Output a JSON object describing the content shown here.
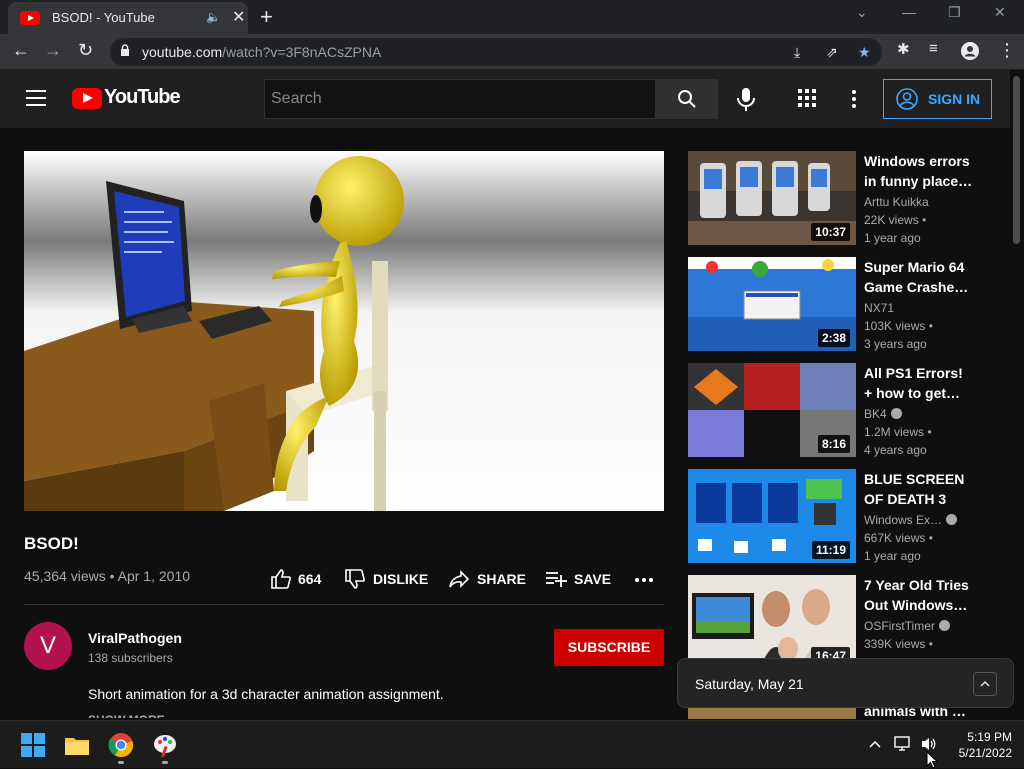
{
  "browser": {
    "tab_title": "BSOD! - YouTube",
    "url_host": "youtube.com",
    "url_path": "/watch?v=3F8nACsZPNA"
  },
  "header": {
    "logo_text": "YouTube",
    "search_placeholder": "Search",
    "sign_in": "SIGN IN"
  },
  "video": {
    "title": "BSOD!",
    "info": "45,364 views • Apr 1, 2010",
    "likes": "664",
    "dislike": "DISLIKE",
    "share": "SHARE",
    "save": "SAVE"
  },
  "channel": {
    "avatar_letter": "V",
    "name": "ViralPathogen",
    "subscribers": "138 subscribers",
    "subscribe": "SUBSCRIBE",
    "description": "Short animation for a 3d character animation assignment.",
    "show_more": "SHOW MORE"
  },
  "related": [
    {
      "title": "Windows errors in funny place…",
      "channel": "Arttu Kuikka",
      "views": "22K views •",
      "ago": "1 year ago",
      "duration": "10:37"
    },
    {
      "title": "Super Mario 64 Game Crashe…",
      "channel": "NX71",
      "views": "103K views •",
      "ago": "3 years ago",
      "duration": "2:38"
    },
    {
      "title": "All PS1 Errors! + how to get…",
      "channel": "BK4",
      "views": "1.2M views •",
      "ago": "4 years ago",
      "duration": "8:16"
    },
    {
      "title": "BLUE SCREEN OF DEATH 3",
      "channel": "Windows Ex…",
      "views": "667K views •",
      "ago": "1 year ago",
      "duration": "11:19"
    },
    {
      "title": "7 Year Old Tries Out Windows…",
      "channel": "OSFirstTimer",
      "views": "339K views •",
      "ago": "",
      "duration": "16:47"
    },
    {
      "title": "animals with …",
      "channel": "",
      "views": "",
      "ago": "",
      "duration": ""
    }
  ],
  "date_popup": "Saturday, May 21",
  "clock": {
    "time": "5:19 PM",
    "date": "5/21/2022"
  }
}
